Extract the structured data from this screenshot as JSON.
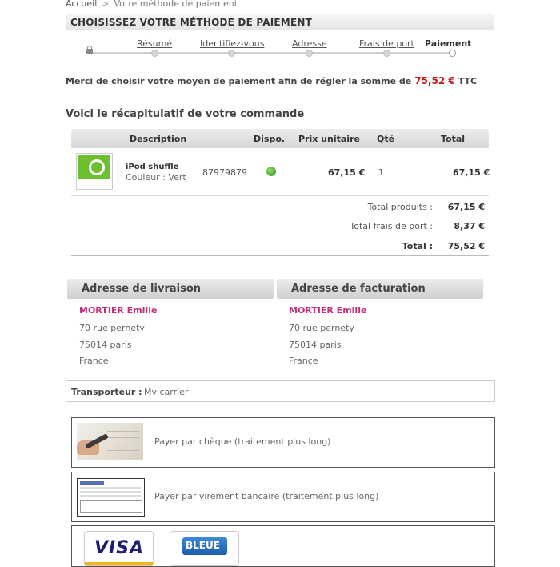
{
  "breadcrumb": {
    "home": "Accueil",
    "separator": ">",
    "current": "Votre méthode de paiement"
  },
  "page_title": "CHOISISSEZ VOTRE MÉTHODE DE PAIEMENT",
  "steps": [
    {
      "label": "Résumé",
      "state": "done"
    },
    {
      "label": "Identifiez-vous",
      "state": "done"
    },
    {
      "label": "Adresse",
      "state": "done"
    },
    {
      "label": "Frais de port",
      "state": "done"
    },
    {
      "label": "Paiement",
      "state": "current"
    }
  ],
  "message": {
    "text": "Merci de choisir votre moyen de paiement afin de régler la somme de",
    "amount": "75,52 €",
    "suffix": "TTC"
  },
  "recap_title": "Voici le récapitulatif de votre commande",
  "table": {
    "headers": {
      "description": "Description",
      "dispo": "Dispo.",
      "unit_price": "Prix unitaire",
      "qty": "Qté",
      "total": "Total"
    },
    "rows": [
      {
        "name": "iPod shuffle",
        "attributes": "Couleur : Vert",
        "reference": "87979879",
        "availability": "in-stock",
        "unit_price": "67,15 €",
        "qty": "1",
        "total": "67,15 €"
      }
    ],
    "totals": [
      {
        "label": "Total produits :",
        "value": "67,15 €"
      },
      {
        "label": "Total frais de port :",
        "value": "8,37 €"
      },
      {
        "label": "Total :",
        "value": "75,52 €"
      }
    ]
  },
  "delivery_address": {
    "title": "Adresse de livraison",
    "name": "MORTIER Emilie",
    "street": "70 rue pernety",
    "city": "75014 paris",
    "country": "France"
  },
  "billing_address": {
    "title": "Adresse de facturation",
    "name": "MORTIER Emilie",
    "street": "70 rue pernety",
    "city": "75014 paris",
    "country": "France"
  },
  "carrier": {
    "label": "Transporteur :",
    "value": "My carrier"
  },
  "payment_methods": [
    {
      "label": "Payer par chèque (traitement plus long)",
      "icon": "cheque-icon"
    },
    {
      "label": "Payer par virement bancaire (traitement plus long)",
      "icon": "bank-transfer-icon"
    }
  ],
  "card_logos": {
    "visa": "VISA",
    "cb": "BLEUE"
  },
  "colors": {
    "amount": "#c01a1a",
    "name": "#c0307a",
    "stock": "#3fae2a"
  }
}
